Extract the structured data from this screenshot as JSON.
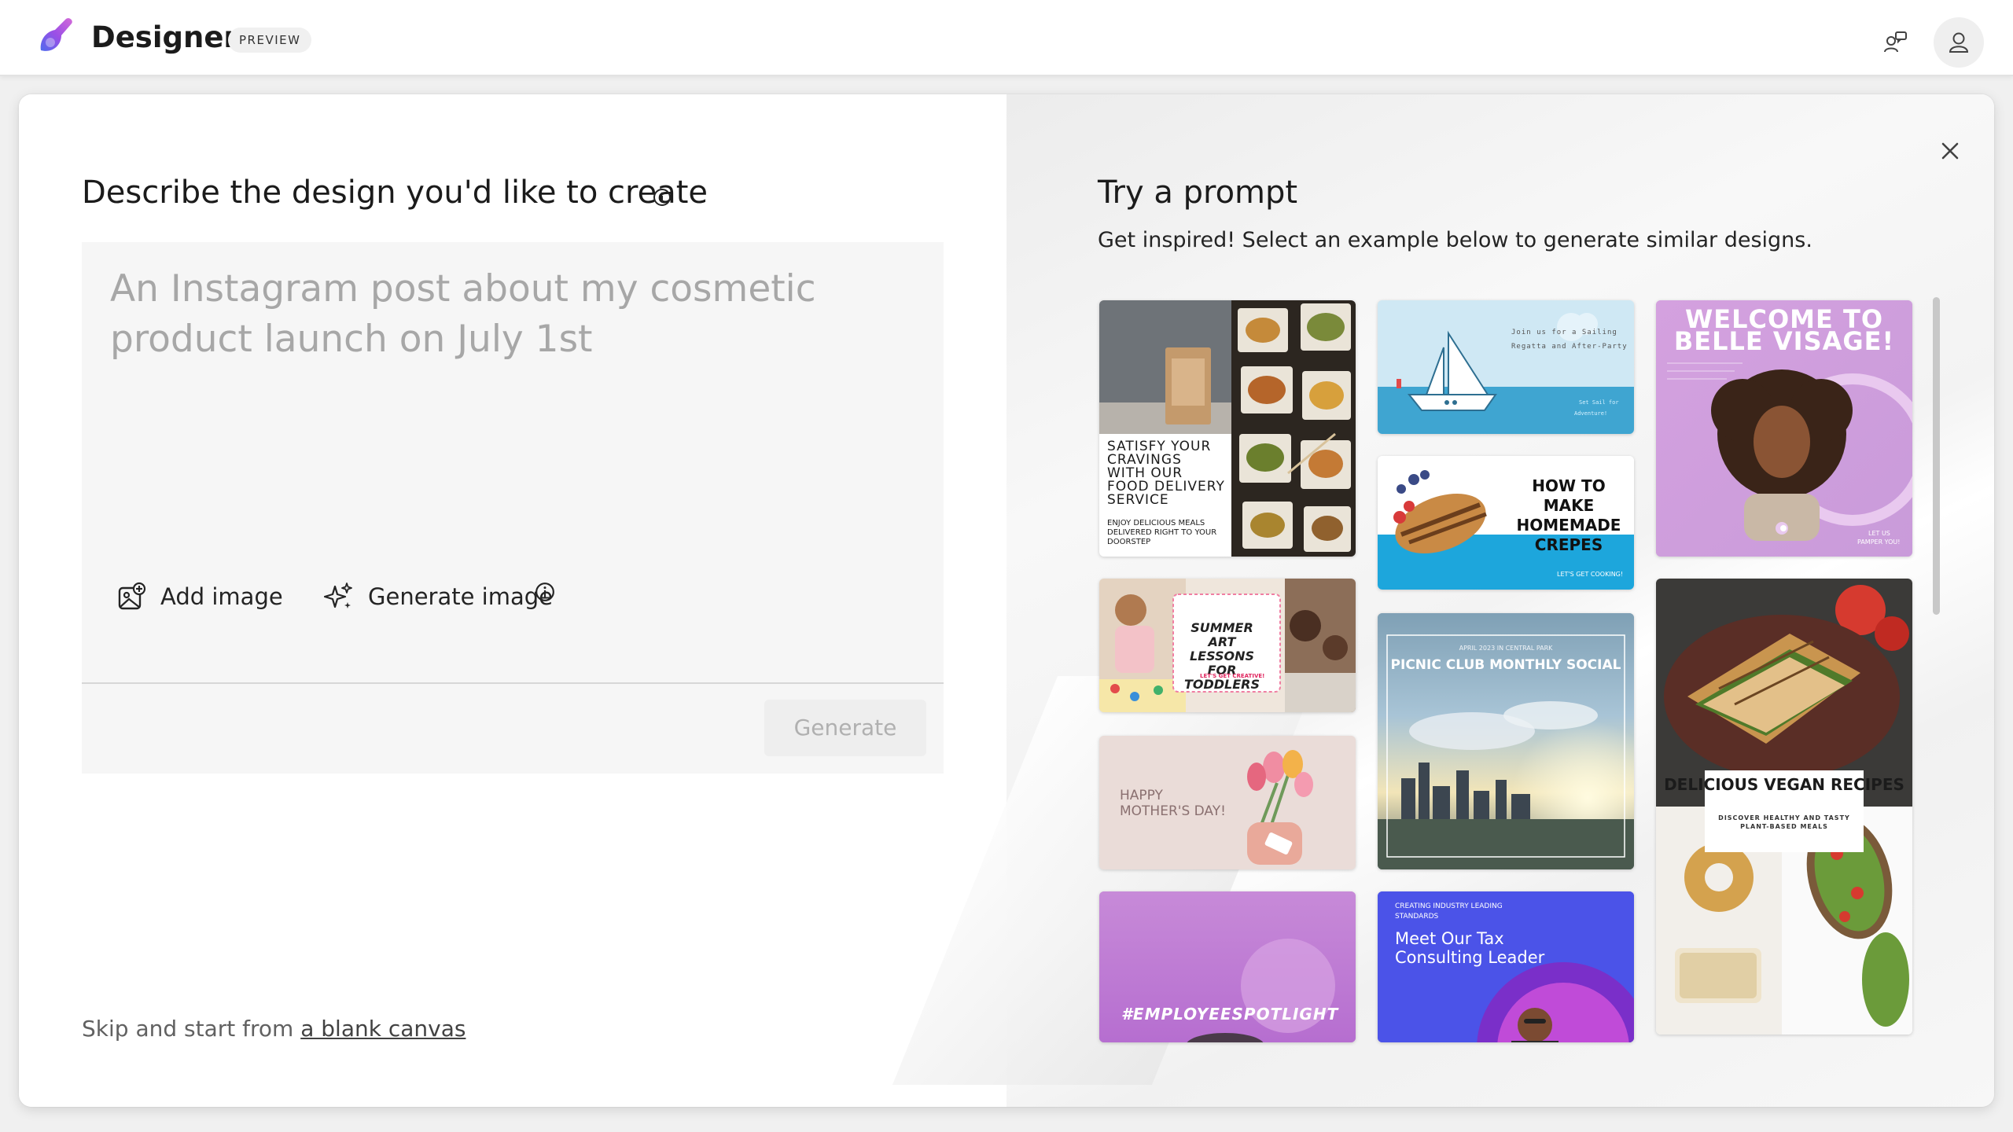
{
  "app": {
    "brand": "Designer",
    "badge": "PREVIEW",
    "icons": {
      "logo": "designer-logo-icon",
      "feedback": "feedback-icon",
      "account": "account-icon"
    },
    "colors": {
      "brand_gradient": [
        "#7b3fe4",
        "#c056e8",
        "#4f6bed"
      ]
    }
  },
  "left": {
    "title": "Describe the design you'd like to create",
    "prompt_placeholder": "An Instagram post about my cosmetic product launch on July 1st",
    "add_image_label": "Add image",
    "generate_image_label": "Generate image",
    "generate_label": "Generate",
    "skip_prefix": "Skip and start from ",
    "skip_link": "a blank canvas"
  },
  "right": {
    "title": "Try a prompt",
    "subtitle": "Get inspired! Select an example below to generate similar designs.",
    "templates": {
      "food": {
        "headline": "SATISFY YOUR CRAVINGS WITH OUR FOOD DELIVERY SERVICE",
        "subtext": "ENJOY DELICIOUS MEALS DELIVERED RIGHT TO YOUR DOORSTEP"
      },
      "sailing": {
        "line1": "Join us for a Sailing",
        "line2": "Regatta and After-Party",
        "line3": "Set Sail for",
        "line4": "Adventure!"
      },
      "crepes": {
        "headline": "HOW TO MAKE HOMEMADE CREPES",
        "subtext": "LET'S GET COOKING!"
      },
      "belle": {
        "headline": "WELCOME TO BELLE VISAGE!",
        "sub1": "LET US",
        "sub2": "PAMPER YOU!"
      },
      "art": {
        "headline": "SUMMER ART LESSONS FOR TODDLERS",
        "subtext": "LET'S GET CREATIVE!"
      },
      "picnic": {
        "pre": "APRIL 2023 IN CENTRAL PARK",
        "headline": "PICNIC CLUB MONTHLY SOCIAL"
      },
      "mothers": {
        "line1": "HAPPY",
        "line2": "MOTHER'S DAY!"
      },
      "vegan": {
        "headline": "DELICIOUS VEGAN RECIPES",
        "sub1": "DISCOVER HEALTHY AND TASTY",
        "sub2": "PLANT-BASED MEALS"
      },
      "employee": {
        "headline": "#EMPLOYEESPOTLIGHT"
      },
      "tax": {
        "pre1": "CREATING INDUSTRY LEADING",
        "pre2": "STANDARDS",
        "line1": "Meet Our Tax",
        "line2": "Consulting Leader"
      }
    }
  }
}
